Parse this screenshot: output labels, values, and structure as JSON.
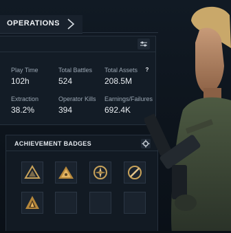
{
  "header": {
    "title": "OPERATIONS",
    "chevron_icon": "chevron-right-icon"
  },
  "stats": {
    "filter_icon": "sliders-icon",
    "items": [
      {
        "label": "Play Time",
        "value": "102h"
      },
      {
        "label": "Total Battles",
        "value": "524"
      },
      {
        "label": "Total Assets",
        "value": "208.5M"
      },
      {
        "label": "Extraction",
        "value": "38.2%"
      },
      {
        "label": "Operator Kills",
        "value": "394"
      },
      {
        "label": "Earnings/Failures",
        "value": "692.4K"
      }
    ],
    "help_glyph": "?"
  },
  "badges": {
    "title": "ACHIEVEMENT BADGES",
    "settings_icon": "gear-icon",
    "slots": [
      {
        "icon": "triangle-badge-icon"
      },
      {
        "icon": "pyramid-badge-icon"
      },
      {
        "icon": "compass-badge-icon"
      },
      {
        "icon": "blade-badge-icon"
      },
      {
        "icon": "flame-badge-icon"
      },
      {
        "icon": "empty-slot"
      },
      {
        "icon": "empty-slot"
      },
      {
        "icon": "empty-slot"
      }
    ]
  },
  "colors": {
    "accent_gold": "#c9a35a",
    "panel": "#131c26",
    "text_primary": "#e9edf1",
    "text_secondary": "#9aa6b2"
  }
}
